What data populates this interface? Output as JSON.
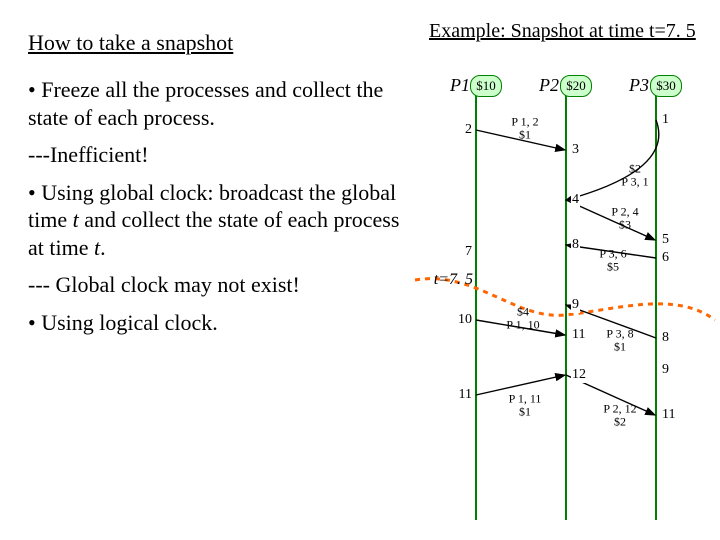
{
  "left": {
    "title": "How to take a snapshot",
    "p1": "• Freeze all the processes and collect the state of each process.",
    "p2": "---Inefficient!",
    "p3a": "• Using global clock: broadcast the global time ",
    "p3b": " and collect the state of each process at time ",
    "p3t": "t",
    "p3end": ".",
    "p4": "--- Global clock may not exist!",
    "p5": "• Using logical clock."
  },
  "diag": {
    "title": "Example: Snapshot at time t=7. 5",
    "p1": "P1",
    "p2": "P2",
    "p3": "P3",
    "b1": "$10",
    "b2": "$20",
    "b3": "$30",
    "t75": "t=7. 5",
    "ticks_p1": {
      "t2": "2",
      "t7": "7",
      "t10": "10",
      "t11": "11"
    },
    "ticks_p2": {
      "t3": "3",
      "t4": "4",
      "t8": "8",
      "t9": "9",
      "t11": "11",
      "t12": "12"
    },
    "ticks_p3": {
      "t1": "1",
      "t5": "5",
      "t6": "6",
      "t8": "8",
      "t9": "9",
      "t11": "11"
    },
    "msgs": {
      "m12": "P 1, 2\n$1",
      "m31": "$2\nP 3, 1",
      "m24": "P 2, 4\n$3",
      "m36": "P 3, 6\n$5",
      "m110": "$4\nP 1, 10",
      "m38": "P 3, 8\n$1",
      "m111": "P 1, 11\n$1",
      "m212": "P 2, 12\n$2"
    }
  }
}
